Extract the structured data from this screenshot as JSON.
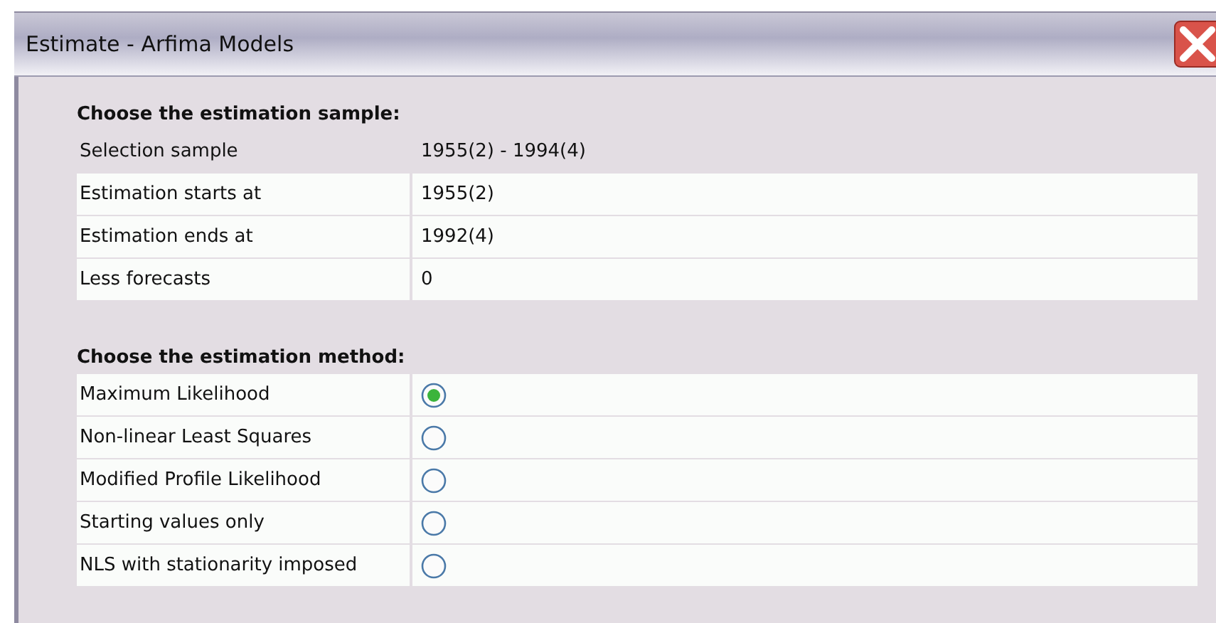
{
  "window": {
    "title": "Estimate - Arfima Models"
  },
  "sample": {
    "heading": "Choose the estimation sample:",
    "rows": [
      {
        "kind": "plain",
        "label": "Selection sample",
        "value": "1955(2) - 1994(4)"
      },
      {
        "kind": "field",
        "label": "Estimation starts at",
        "value": "1955(2)"
      },
      {
        "kind": "field",
        "label": "Estimation ends at",
        "value": "1992(4)"
      },
      {
        "kind": "field",
        "label": "Less forecasts",
        "value": "0"
      }
    ]
  },
  "method": {
    "heading": "Choose the estimation method:",
    "options": [
      {
        "label": "Maximum Likelihood",
        "selected": true
      },
      {
        "label": "Non-linear Least Squares",
        "selected": false
      },
      {
        "label": "Modified Profile Likelihood",
        "selected": false
      },
      {
        "label": "Starting values only",
        "selected": false
      },
      {
        "label": "NLS with stationarity imposed",
        "selected": false
      }
    ]
  }
}
